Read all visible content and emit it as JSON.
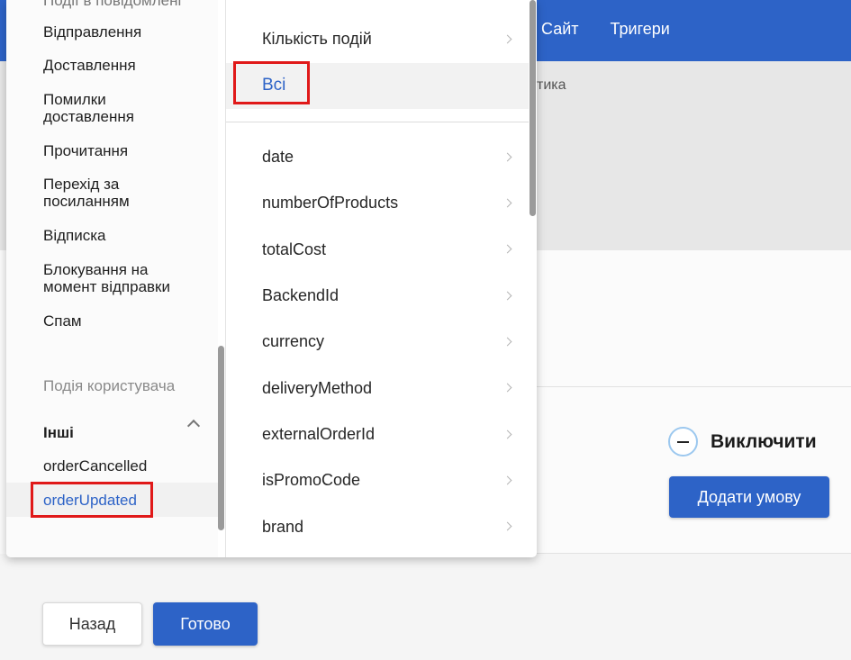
{
  "topnav": [
    "Сайт",
    "Тригери"
  ],
  "breadcrumb_fragment": "тика",
  "exclude_label": "Виключити",
  "add_condition_label": "Додати умову",
  "back_label": "Назад",
  "done_label": "Готово",
  "left_menu": {
    "cut_item": "Події в повідомлені",
    "items": [
      "Відправлення",
      "Доставлення",
      "Помилки\nдоставлення",
      "Прочитання",
      "Перехід за\nпосиланням",
      "Відписка",
      "Блокування на\nмомент відправки",
      "Спам"
    ],
    "section_user_events": "Подія користувача",
    "group_other": "Інші",
    "other_items": [
      "orderCancelled",
      "orderUpdated"
    ]
  },
  "right_menu": {
    "event_count": "Кількість подій",
    "all": "Всі",
    "fields": [
      "date",
      "numberOfProducts",
      "totalCost",
      "BackendId",
      "currency",
      "deliveryMethod",
      "externalOrderId",
      "isPromoCode",
      "brand"
    ]
  },
  "colors": {
    "accent": "#2d63c7",
    "highlight": "#e01919"
  }
}
